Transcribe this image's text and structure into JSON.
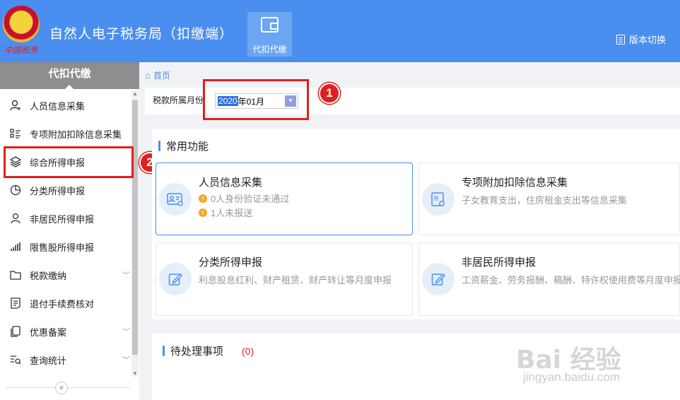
{
  "header": {
    "emblem_text": "中国税务",
    "app_title": "自然人电子税务局（扣缴端）",
    "nav_tile_label": "代扣代缴",
    "version_switch": "版本切换"
  },
  "sidebar": {
    "title": "代扣代缴",
    "items": [
      {
        "label": "人员信息采集",
        "icon": "person-icon"
      },
      {
        "label": "专项附加扣除信息采集",
        "icon": "list-icon"
      },
      {
        "label": "综合所得申报",
        "icon": "layers-icon"
      },
      {
        "label": "分类所得申报",
        "icon": "pie-icon"
      },
      {
        "label": "非居民所得申报",
        "icon": "person-outline-icon"
      },
      {
        "label": "限售股所得申报",
        "icon": "bar-chart-icon"
      },
      {
        "label": "税款缴纳",
        "icon": "folder-icon"
      },
      {
        "label": "退付手续费核对",
        "icon": "document-icon"
      },
      {
        "label": "优惠备案",
        "icon": "copy-icon"
      },
      {
        "label": "查询统计",
        "icon": "search-list-icon"
      }
    ],
    "collapse_glyph": "«"
  },
  "breadcrumb": {
    "home": "首页"
  },
  "filter": {
    "label": "税款所属月份",
    "year": "2020",
    "rest": "年01月"
  },
  "annotations": [
    "1",
    "2"
  ],
  "common": {
    "title": "常用功能",
    "cards": [
      {
        "title": "人员信息采集",
        "warnings": [
          "0人身份验证未通过",
          "1人未报送"
        ]
      },
      {
        "title": "专项附加扣除信息采集",
        "sub": "子女教育支出，住房租金支出等信息采集"
      },
      {
        "title": "分类所得申报",
        "sub": "利息股息红利、财产租赁、财产转让等月度申报"
      },
      {
        "title": "非居民所得申报",
        "sub": "工资薪金、劳务报酬、稿酬、特许权使用费等月度申报"
      }
    ]
  },
  "pending": {
    "title": "待处理事项",
    "count": "(0)"
  },
  "watermark": {
    "main": "Bai 经验",
    "sub": "jingyan.baidu.com"
  },
  "colors": {
    "header": "#4a8ff0",
    "accent": "#4a8ff0",
    "annotation": "#e02020",
    "warning": "#f5a623"
  }
}
